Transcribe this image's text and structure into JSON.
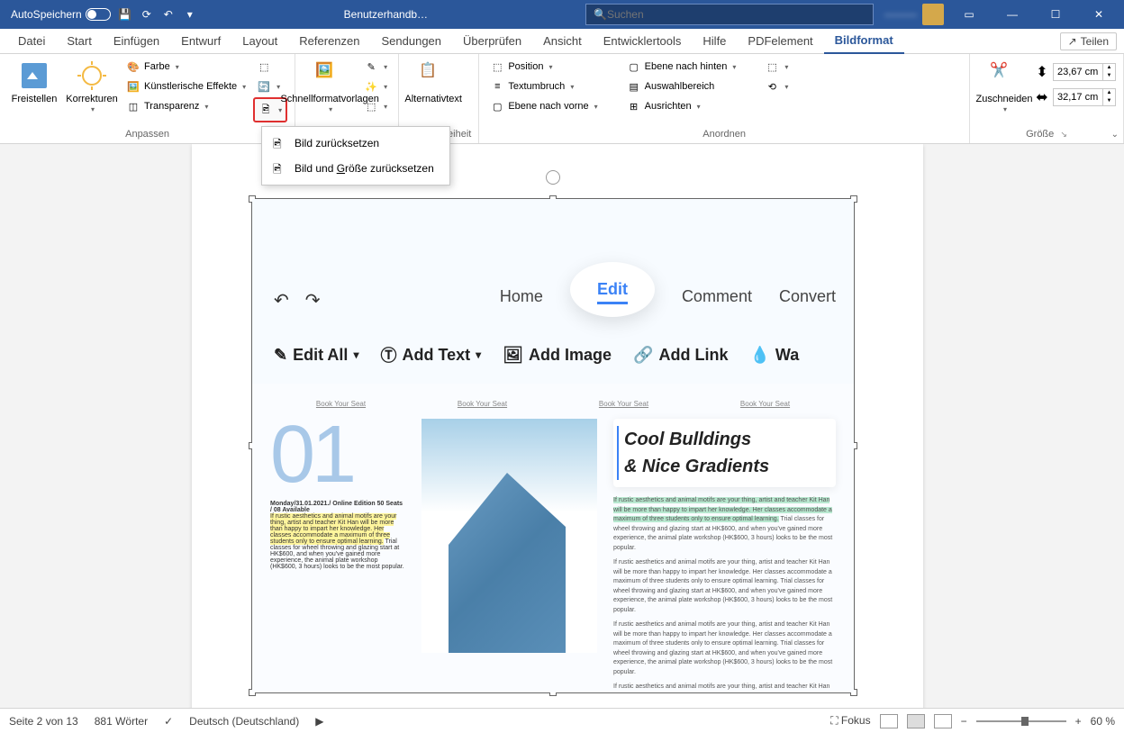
{
  "titlebar": {
    "autosave_label": "AutoSpeichern",
    "doc_title": "Benutzerhandb…",
    "search_placeholder": "Suchen",
    "user_name": "———"
  },
  "tabs": {
    "items": [
      "Datei",
      "Start",
      "Einfügen",
      "Entwurf",
      "Layout",
      "Referenzen",
      "Sendungen",
      "Überprüfen",
      "Ansicht",
      "Entwicklertools",
      "Hilfe",
      "PDFelement",
      "Bildformat"
    ],
    "active": "Bildformat",
    "share": "Teilen"
  },
  "ribbon": {
    "anpassen": {
      "freistellen": "Freistellen",
      "korrekturen": "Korrekturen",
      "farbe": "Farbe",
      "effekte": "Künstlerische Effekte",
      "transparenz": "Transparenz",
      "label": "Anpassen"
    },
    "formatvorlagen": {
      "schnell": "Schnellformatvorlagen",
      "label": ""
    },
    "alttext": {
      "label_btn": "Alternativtext",
      "group": "Barrierefreiheit"
    },
    "anordnen": {
      "position": "Position",
      "textumbruch": "Textumbruch",
      "ebene_vorn": "Ebene nach vorne",
      "ebene_hinten": "Ebene nach hinten",
      "auswahlbereich": "Auswahlbereich",
      "ausrichten": "Ausrichten",
      "label": "Anordnen"
    },
    "groesse": {
      "zuschneiden": "Zuschneiden",
      "height": "23,67 cm",
      "width": "32,17 cm",
      "label": "Größe"
    }
  },
  "dropdown": {
    "item1": "Bild zurücksetzen",
    "item2_prefix": "Bild und ",
    "item2_u": "G",
    "item2_suffix": "röße zurücksetzen"
  },
  "image_content": {
    "tabs": {
      "home": "Home",
      "edit": "Edit",
      "comment": "Comment",
      "convert": "Convert"
    },
    "tools": {
      "edit_all": "Edit All",
      "add_text": "Add Text",
      "add_image": "Add Image",
      "add_link": "Add Link",
      "wa": "Wa"
    },
    "book": "Book Your Seat",
    "big_num": "01",
    "col1_bold": "Monday/31.01.2021./ Online Edition 50 Seats / 08 Available",
    "col1_hl": "If rustic aesthetics and animal motifs are your thing, artist and teacher Kit Han will be more than happy to impart her knowledge. Her classes accommodate a maximum of three students only to ensure optimal learning.",
    "col1_rest": " Trial classes for wheel throwing and glazing start at HK$600, and when you've gained more experience, the animal plate workshop (HK$600, 3 hours) looks to be the most popular.",
    "heading1": "Cool Bulldings",
    "heading2": "& Nice Gradients",
    "para_hl": "If rustic aesthetics and animal motifs are your thing, artist and teacher Kit Han will be more than happy to impart her knowledge. Her classes accommodate a maximum of three students only to ensure optimal learning.",
    "para_rest": " Trial classes for wheel throwing and glazing start at HK$600, and when you've gained more experience, the animal plate workshop (HK$600, 3 hours) looks to be the most popular.",
    "para2": "If rustic aesthetics and animal motifs are your thing, artist and teacher Kit Han will be more than happy to impart her knowledge. Her classes accommodate a maximum of three students only to ensure optimal learning. Trial classes for wheel throwing and glazing start at HK$600, and when you've gained more experience, the animal plate workshop (HK$600, 3 hours) looks to be the most popular.",
    "para3": "If rustic aesthetics and animal motifs are your thing, artist and teacher Kit Han will be more than happy to impart her knowledge. Her classes accommodate a maximum of three students only to ensure optimal learning. Trial classes for wheel throwing and glazing start at HK$600, and when you've gained more experience, the animal plate workshop (HK$600, 3 hours) looks to be the most popular.",
    "para4": "If rustic aesthetics and animal motifs are your thing, artist and teacher Kit Han will be more than happy to impart her knowledge. Her classes accommodate a maximum of three students only to ensure optimal learning."
  },
  "statusbar": {
    "page": "Seite 2 von 13",
    "words": "881 Wörter",
    "lang": "Deutsch (Deutschland)",
    "fokus": "Fokus",
    "zoom": "60 %"
  }
}
